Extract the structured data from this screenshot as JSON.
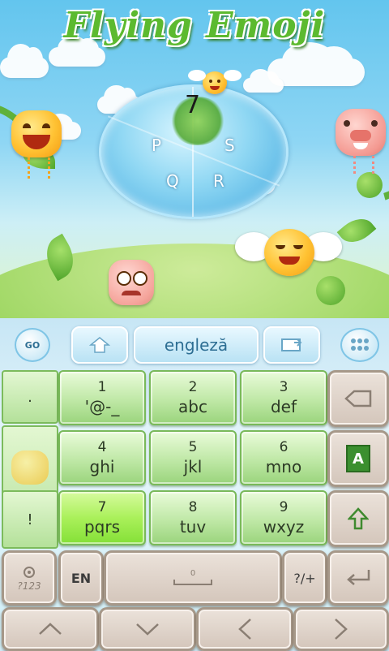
{
  "banner": {
    "title": "Flying Emoji",
    "bubble_number": "7",
    "bubble_letters": [
      "P",
      "S",
      "Q",
      "R"
    ]
  },
  "toolbar": {
    "go_label": "GO",
    "language": "engleză"
  },
  "side_column": [
    ".",
    "?",
    "!"
  ],
  "keys": [
    {
      "num": "1",
      "letters": "'@-_"
    },
    {
      "num": "2",
      "letters": "abc"
    },
    {
      "num": "3",
      "letters": "def"
    },
    {
      "num": "4",
      "letters": "ghi"
    },
    {
      "num": "5",
      "letters": "jkl"
    },
    {
      "num": "6",
      "letters": "mno"
    },
    {
      "num": "7",
      "letters": "pqrs"
    },
    {
      "num": "8",
      "letters": "tuv"
    },
    {
      "num": "9",
      "letters": "wxyz"
    }
  ],
  "bottom_row": {
    "symbols_label": "?123",
    "lang_key": "EN",
    "space_label": "0",
    "punct_key": "?/+"
  },
  "colors": {
    "sky": "#63c5ee",
    "green_key": "#bfe8a6",
    "stone_key": "#d4c6bb",
    "title_green": "#5cba2f"
  }
}
